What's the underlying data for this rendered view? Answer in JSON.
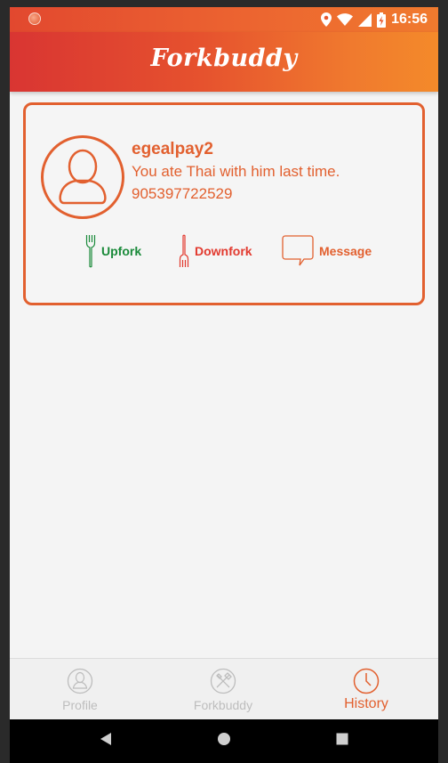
{
  "status_bar": {
    "time": "16:56"
  },
  "app_bar": {
    "title": "Forkbuddy"
  },
  "history_card": {
    "username": "egealpay2",
    "note": "You ate Thai with him last time.",
    "phone": "905397722529",
    "actions": {
      "upfork": "Upfork",
      "downfork": "Downfork",
      "message": "Message"
    }
  },
  "bottom_nav": {
    "items": [
      {
        "label": "Profile",
        "icon": "user-icon",
        "active": false
      },
      {
        "label": "Forkbuddy",
        "icon": "fork-knife-icon",
        "active": false
      },
      {
        "label": "History",
        "icon": "clock-icon",
        "active": true
      }
    ]
  },
  "colors": {
    "accent": "#e2602f",
    "upfork": "#1a8a3a",
    "downfork": "#e23a2f",
    "inactive": "#bdbdbd"
  }
}
